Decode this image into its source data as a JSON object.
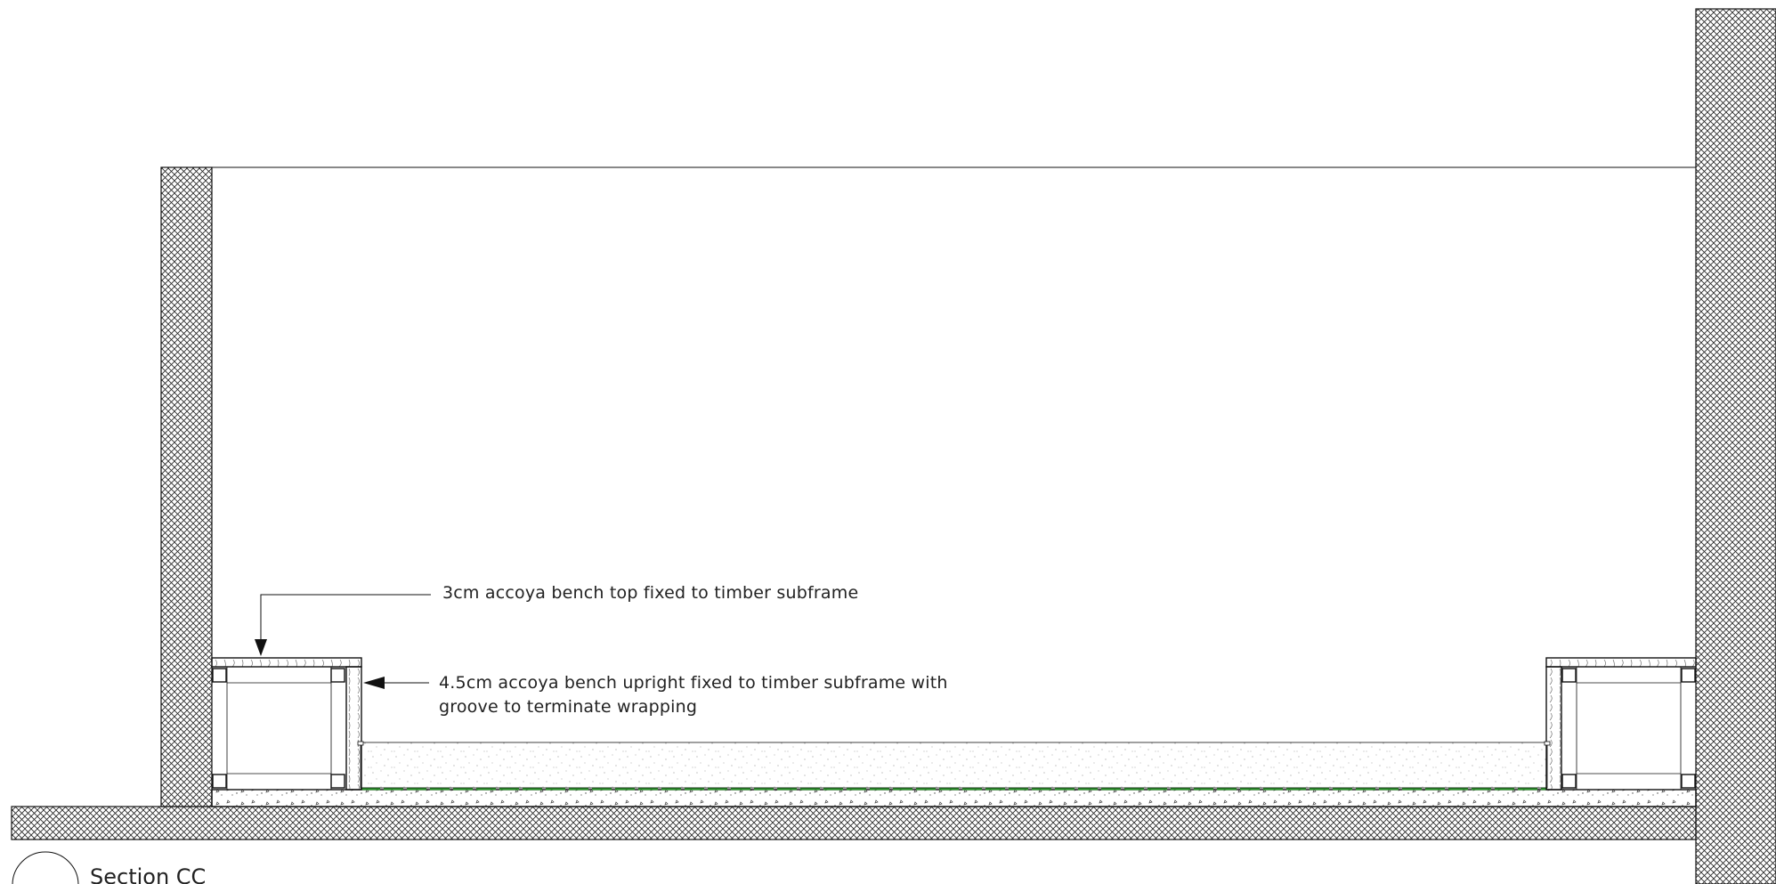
{
  "drawing": {
    "title": "Section CC",
    "annotations": {
      "bench_top": "3cm accoya bench top fixed to timber subframe",
      "bench_upright_line1": "4.5cm accoya bench upright fixed to timber subframe with",
      "bench_upright_line2": "groove to terminate wrapping"
    }
  },
  "colors": {
    "line": "#111111",
    "membrane": "#2e9a2e",
    "hatch": "#222222"
  }
}
